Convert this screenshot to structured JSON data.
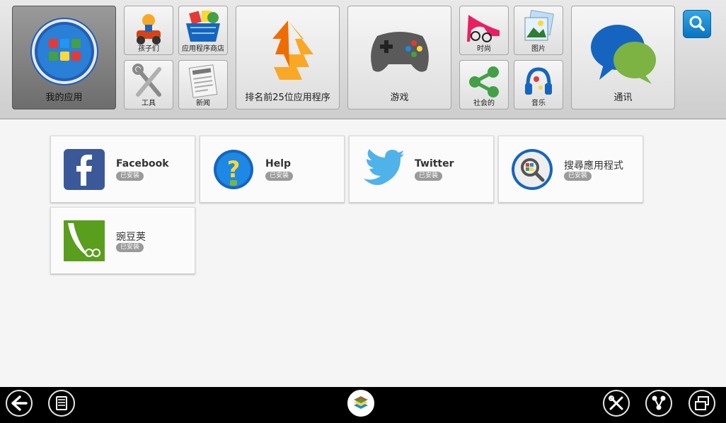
{
  "top_nav": {
    "my_apps": "我的应用",
    "kids": "孩子们",
    "app_store": "应用程序商店",
    "tools": "工具",
    "news": "新闻",
    "top25": "排名前25位应用程序",
    "games": "游戏",
    "fashion": "时尚",
    "pictures": "图片",
    "social": "社会的",
    "music": "音乐",
    "communication": "通讯"
  },
  "apps": [
    {
      "name": "Facebook",
      "status": "已安装",
      "icon": "facebook-icon"
    },
    {
      "name": "Help",
      "status": "已安装",
      "icon": "help-icon"
    },
    {
      "name": "Twitter",
      "status": "已安装",
      "icon": "twitter-icon"
    },
    {
      "name": "搜尋應用程式",
      "status": "已安裝",
      "icon": "app-search-icon"
    },
    {
      "name": "豌豆荚",
      "status": "已安装",
      "icon": "wandoujia-icon"
    }
  ],
  "icons": {
    "search": "search-icon",
    "back": "back-arrow-icon",
    "menu": "menu-icon",
    "home": "bluestacks-logo",
    "settings": "tools-icon",
    "share": "share-icon",
    "window": "window-mode-icon"
  },
  "colors": {
    "accent_blue": "#0a74c2",
    "badge_gray": "#9a9a9a",
    "bottom_bar": "#000000"
  }
}
